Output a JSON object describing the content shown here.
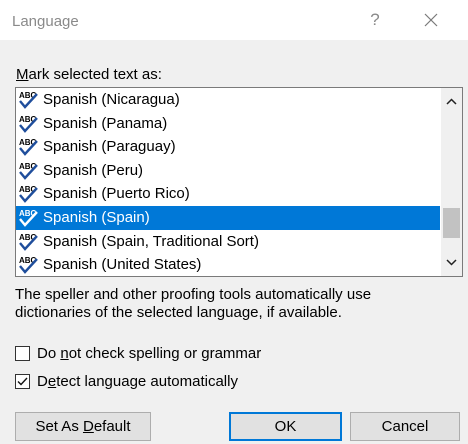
{
  "dialog": {
    "title": "Language",
    "help_label": "?",
    "close_icon": "close-icon"
  },
  "mark_label": {
    "prefix": "",
    "accel": "M",
    "rest": "ark selected text as:"
  },
  "languages": [
    {
      "label": "Spanish (Nicaragua)",
      "selected": false
    },
    {
      "label": "Spanish (Panama)",
      "selected": false
    },
    {
      "label": "Spanish (Paraguay)",
      "selected": false
    },
    {
      "label": "Spanish (Peru)",
      "selected": false
    },
    {
      "label": "Spanish (Puerto Rico)",
      "selected": false
    },
    {
      "label": "Spanish (Spain)",
      "selected": true
    },
    {
      "label": "Spanish (Spain, Traditional Sort)",
      "selected": false
    },
    {
      "label": "Spanish (United States)",
      "selected": false
    }
  ],
  "description": {
    "line1": "The speller and other proofing tools automatically use",
    "line2": "dictionaries of the selected language, if available."
  },
  "checkboxes": {
    "no_check": {
      "prefix": "Do ",
      "accel": "n",
      "rest": "ot check spelling or grammar",
      "checked": false
    },
    "detect": {
      "prefix": "D",
      "accel": "e",
      "rest": "tect language automatically",
      "checked": true
    }
  },
  "buttons": {
    "set_default": {
      "prefix": "Set As ",
      "accel": "D",
      "rest": "efault"
    },
    "ok": "OK",
    "cancel": "Cancel"
  },
  "colors": {
    "selection": "#0078d7",
    "spell_icon_blue": "#1f4e9c"
  }
}
